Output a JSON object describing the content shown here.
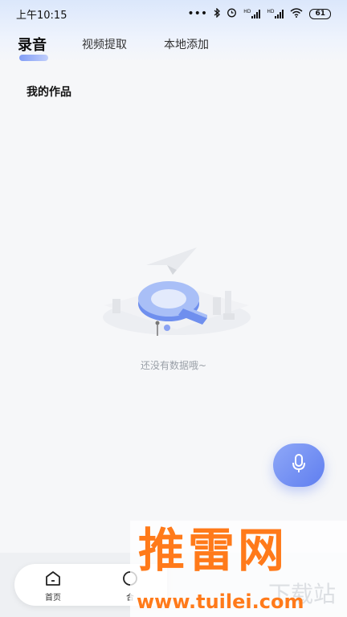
{
  "status_bar": {
    "time": "上午10:15",
    "dots": "•••",
    "hd1": "HD",
    "hd2": "HD",
    "battery": "61"
  },
  "tabs": [
    {
      "label": "录音",
      "active": true
    },
    {
      "label": "视频提取",
      "active": false
    },
    {
      "label": "本地添加",
      "active": false
    }
  ],
  "section": {
    "title": "我的作品"
  },
  "empty_state": {
    "text": "还没有数据哦~"
  },
  "fab": {
    "icon": "microphone-icon"
  },
  "bottom_nav": {
    "items": [
      {
        "label": "首页",
        "icon": "home-icon"
      },
      {
        "label": "合",
        "icon": "circle-icon"
      }
    ]
  },
  "watermark": {
    "brand": "推雷网",
    "url": "www.tuilei.com",
    "side_text": "下载站"
  },
  "colors": {
    "accent": "#6d8df5",
    "fab": "#5f7ef0",
    "watermark": "#ff7a1a"
  }
}
